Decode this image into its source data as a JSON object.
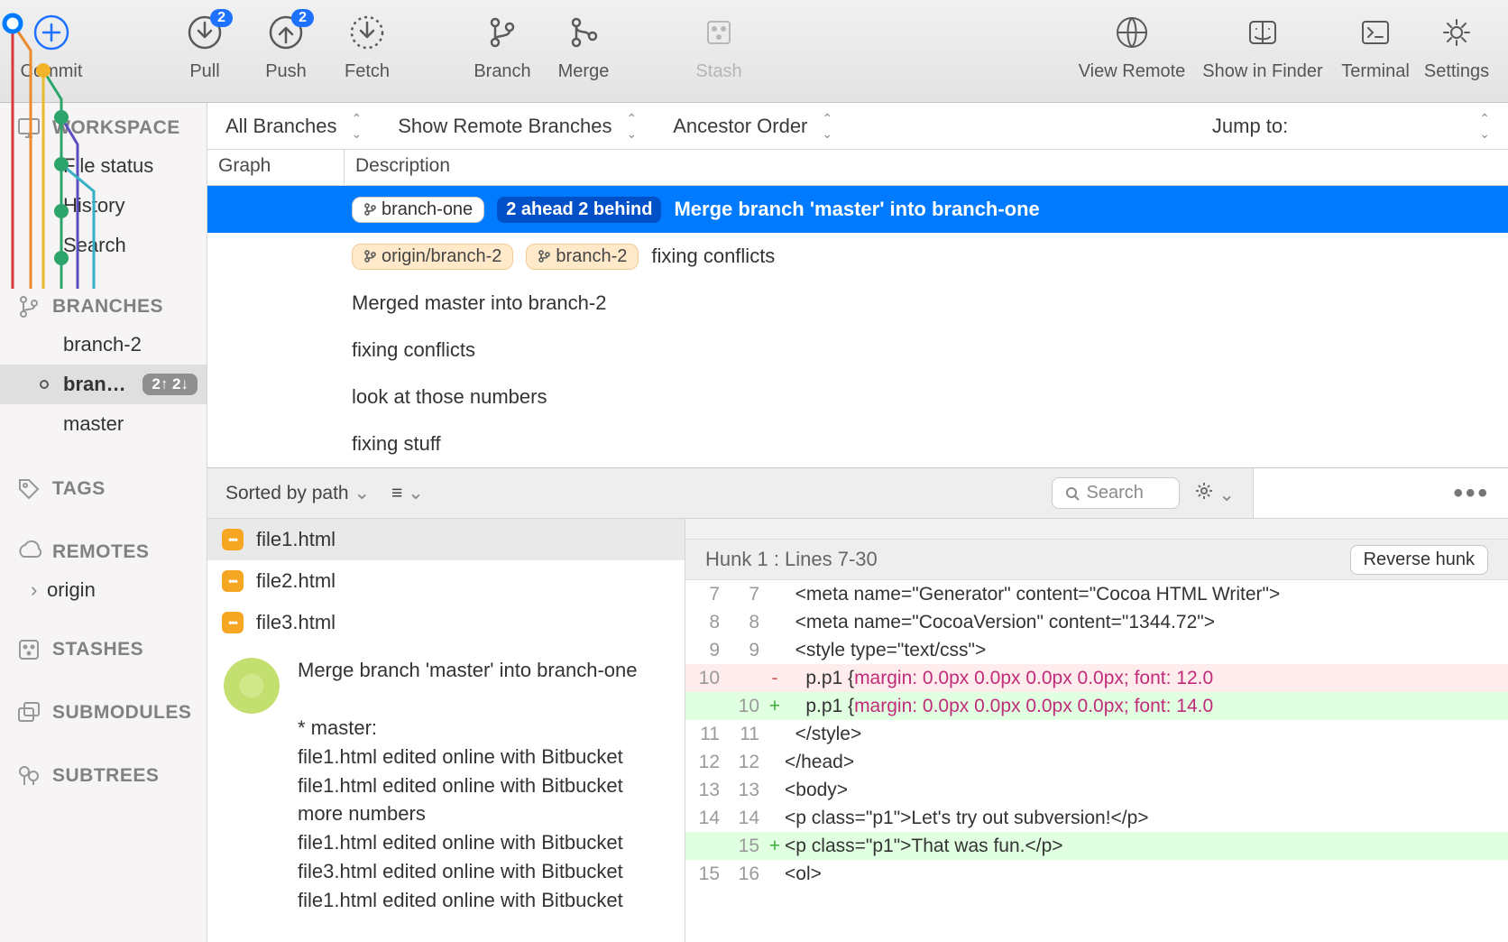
{
  "toolbar": {
    "items": [
      {
        "id": "commit",
        "label": "Commit"
      },
      {
        "id": "pull",
        "label": "Pull",
        "badge": "2"
      },
      {
        "id": "push",
        "label": "Push",
        "badge": "2"
      },
      {
        "id": "fetch",
        "label": "Fetch"
      },
      {
        "id": "branch",
        "label": "Branch"
      },
      {
        "id": "merge",
        "label": "Merge"
      },
      {
        "id": "stash",
        "label": "Stash",
        "disabled": true
      },
      {
        "id": "view-remote",
        "label": "View Remote"
      },
      {
        "id": "show-in-finder",
        "label": "Show in Finder"
      },
      {
        "id": "terminal",
        "label": "Terminal"
      },
      {
        "id": "settings",
        "label": "Settings"
      }
    ]
  },
  "sidebar": {
    "workspace": {
      "label": "WORKSPACE",
      "items": [
        "File status",
        "History",
        "Search"
      ]
    },
    "branches": {
      "label": "BRANCHES",
      "items": [
        {
          "name": "branch-2"
        },
        {
          "name": "bran…",
          "selected": true,
          "badge": "2↑ 2↓"
        },
        {
          "name": "master"
        }
      ]
    },
    "tags": {
      "label": "TAGS"
    },
    "remotes": {
      "label": "REMOTES",
      "items": [
        "origin"
      ]
    },
    "stashes": {
      "label": "STASHES"
    },
    "submodules": {
      "label": "SUBMODULES"
    },
    "subtrees": {
      "label": "SUBTREES"
    }
  },
  "filters": {
    "all_branches": "All Branches",
    "show_remote": "Show Remote Branches",
    "order": "Ancestor Order",
    "jump": "Jump to:"
  },
  "history": {
    "graph_label": "Graph",
    "desc_label": "Description",
    "rows": [
      {
        "selected": true,
        "tags": [
          {
            "t": "branch-one",
            "kind": "local"
          }
        ],
        "pill": "2 ahead 2 behind",
        "msg": "Merge branch 'master' into branch-one"
      },
      {
        "tags": [
          {
            "t": "origin/branch-2",
            "kind": "remote"
          },
          {
            "t": "branch-2",
            "kind": "remote"
          }
        ],
        "msg": "fixing conflicts"
      },
      {
        "msg": "Merged master into branch-2"
      },
      {
        "msg": "fixing conflicts"
      },
      {
        "msg": "look at those numbers"
      },
      {
        "msg": "fixing stuff"
      }
    ]
  },
  "file_panel": {
    "sort": "Sorted by path",
    "search_placeholder": "Search",
    "files": [
      "file1.html",
      "file2.html",
      "file3.html"
    ],
    "selected_file": "file1.html",
    "commit_message": {
      "title": "Merge branch 'master' into branch-one",
      "body": "* master:\nfile1.html edited online with Bitbucket\nfile1.html edited online with Bitbucket\nmore numbers\nfile1.html edited online with Bitbucket\nfile3.html edited online with Bitbucket\nfile1.html edited online with Bitbucket"
    }
  },
  "diff": {
    "file": "file1.html",
    "hunk": "Hunk 1 : Lines 7-30",
    "reverse": "Reverse hunk",
    "lines": [
      {
        "ol": "7",
        "nl": "7",
        "k": "ctx",
        "t": "  <meta name=\"Generator\" content=\"Cocoa HTML Writer\">"
      },
      {
        "ol": "8",
        "nl": "8",
        "k": "ctx",
        "t": "  <meta name=\"CocoaVersion\" content=\"1344.72\">"
      },
      {
        "ol": "9",
        "nl": "9",
        "k": "ctx",
        "t": "  <style type=\"text/css\">"
      },
      {
        "ol": "10",
        "nl": "",
        "k": "del",
        "t": "    p.p1 {margin: 0.0px 0.0px 0.0px 0.0px; font: 12.0"
      },
      {
        "ol": "",
        "nl": "10",
        "k": "add",
        "t": "    p.p1 {margin: 0.0px 0.0px 0.0px 0.0px; font: 14.0"
      },
      {
        "ol": "11",
        "nl": "11",
        "k": "ctx",
        "t": "  </style>"
      },
      {
        "ol": "12",
        "nl": "12",
        "k": "ctx",
        "t": "</head>"
      },
      {
        "ol": "13",
        "nl": "13",
        "k": "ctx",
        "t": "<body>"
      },
      {
        "ol": "14",
        "nl": "14",
        "k": "ctx",
        "t": "<p class=\"p1\">Let's try out subversion!</p>"
      },
      {
        "ol": "",
        "nl": "15",
        "k": "add",
        "t": "<p class=\"p1\">That was fun.</p>"
      },
      {
        "ol": "15",
        "nl": "16",
        "k": "ctx",
        "t": "<ol>"
      }
    ]
  }
}
